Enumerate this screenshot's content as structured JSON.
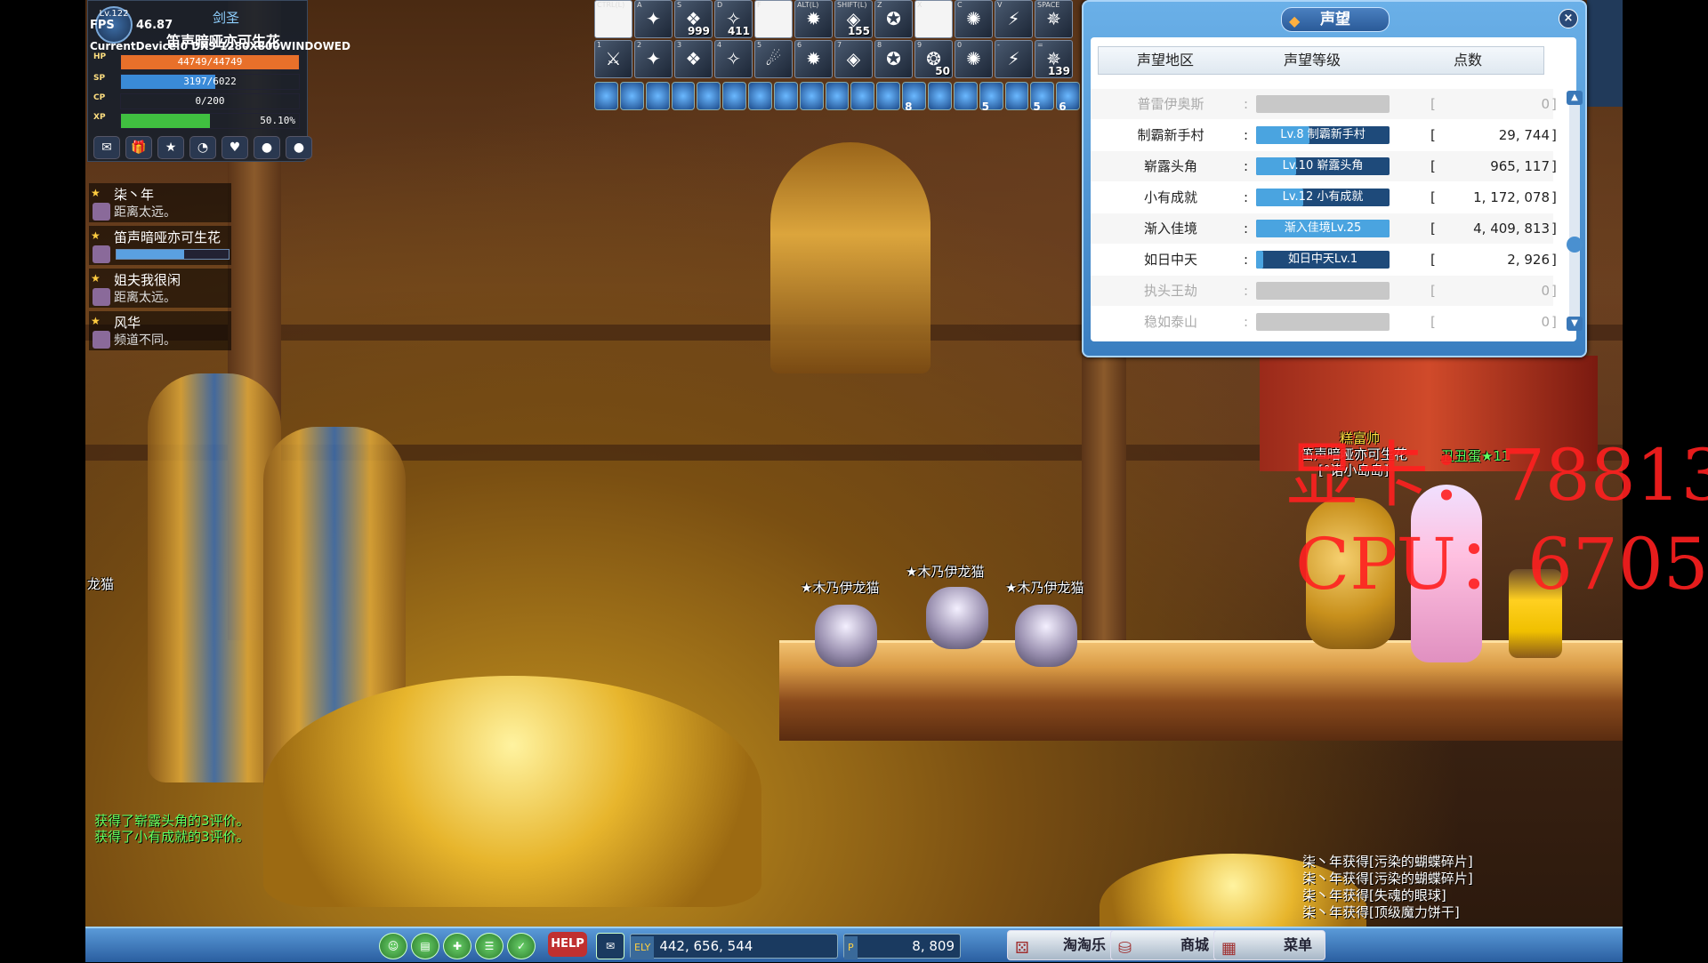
{
  "status": {
    "level_badge": "Lv.122",
    "class_name": "剑圣",
    "fps_label": "FPS",
    "fps_value": "46.87",
    "device_text": "CurrentDevice:0 DX9 1280X800WINDOWED",
    "player_name": "笛声暗哑亦可生花",
    "hp": {
      "label": "HP",
      "text": "44749/44749",
      "fraction": 1.0,
      "color": "#e8702a"
    },
    "sp": {
      "label": "SP",
      "text": "3197/6022",
      "fraction": 0.53,
      "color": "#3a8ad8"
    },
    "cp": {
      "label": "CP",
      "text": "0/200",
      "fraction": 0.0,
      "color": "#6a6aaa"
    },
    "xp": {
      "label": "XP",
      "text": "50.10%",
      "fraction": 0.501,
      "color": "#40c040"
    },
    "icons": [
      "mail-icon",
      "gift-icon",
      "star-icon",
      "clock-icon",
      "heart-icon",
      "orb-icon",
      "orb2-icon"
    ]
  },
  "party": [
    {
      "name": "柒丶年",
      "sub": "距离太远。"
    },
    {
      "name": "笛声暗哑亦可生花",
      "hp_fraction": 0.6
    },
    {
      "name": "姐夫我很闲",
      "sub": "距离太远。"
    },
    {
      "name": "风华",
      "sub": "频道不同。"
    }
  ],
  "skills": {
    "row1": [
      {
        "key": "CTRL(L)",
        "count": "",
        "empty": true
      },
      {
        "key": "A",
        "count": ""
      },
      {
        "key": "S",
        "count": "999"
      },
      {
        "key": "D",
        "count": "411"
      },
      {
        "key": "F",
        "count": "",
        "empty": true
      },
      {
        "key": "ALT(L)",
        "count": ""
      },
      {
        "key": "SHIFT(L)",
        "count": "155"
      },
      {
        "key": "Z",
        "count": ""
      },
      {
        "key": "X",
        "count": "",
        "empty": true
      },
      {
        "key": "C",
        "count": ""
      },
      {
        "key": "V",
        "count": ""
      },
      {
        "key": "SPACE",
        "count": ""
      }
    ],
    "row2": [
      {
        "key": "1",
        "count": ""
      },
      {
        "key": "2",
        "count": ""
      },
      {
        "key": "3",
        "count": ""
      },
      {
        "key": "4",
        "count": ""
      },
      {
        "key": "5",
        "count": ""
      },
      {
        "key": "6",
        "count": ""
      },
      {
        "key": "7",
        "count": ""
      },
      {
        "key": "8",
        "count": ""
      },
      {
        "key": "9",
        "count": "50"
      },
      {
        "key": "0",
        "count": ""
      },
      {
        "key": "-",
        "count": ""
      },
      {
        "key": "=",
        "count": "139"
      }
    ],
    "buff_counts": [
      "",
      "",
      "",
      "",
      "",
      "",
      "",
      "",
      "",
      "",
      "",
      "",
      "8",
      "",
      "",
      "5",
      "",
      "5",
      "6"
    ]
  },
  "reputation": {
    "title": "声望",
    "headers": [
      "声望地区",
      "声望等级",
      "点数"
    ],
    "rows": [
      {
        "area": "普雷伊奥斯",
        "level": "",
        "fill": 0,
        "points": "0",
        "dim": true
      },
      {
        "area": "制霸新手村",
        "level": "Lv.8 制霸新手村",
        "fill": 0.4,
        "points": "29, 744",
        "dim": false
      },
      {
        "area": "崭露头角",
        "level": "Lv.10 崭露头角",
        "fill": 0.3,
        "points": "965, 117",
        "dim": false
      },
      {
        "area": "小有成就",
        "level": "Lv.12 小有成就",
        "fill": 0.35,
        "points": "1, 172, 078",
        "dim": false
      },
      {
        "area": "渐入佳境",
        "level": "渐入佳境Lv.25",
        "fill": 1.0,
        "points": "4, 409, 813",
        "dim": false
      },
      {
        "area": "如日中天",
        "level": "如日中天Lv.1",
        "fill": 0.05,
        "points": "2, 926",
        "dim": false
      },
      {
        "area": "执头王劫",
        "level": "",
        "fill": 0,
        "points": "0",
        "dim": true
      },
      {
        "area": "稳如泰山",
        "level": "",
        "fill": 0,
        "points": "0",
        "dim": true
      }
    ]
  },
  "world": {
    "mob_name": "★木乃伊龙猫",
    "left_edge_name": "龙猫",
    "player_title": "糕富帅",
    "player_tag": "笛声暗哑亦可生花",
    "player_guild": "[°诺小岛岛]",
    "pet_name": "丑丑蛋★11",
    "watermark_gpu": "显卡：78813",
    "watermark_cpu": "CPU：6705"
  },
  "system_messages": [
    "获得了崭露头角的3评价。",
    "获得了小有成就的3评价。"
  ],
  "chat_log": [
    "柒丶年获得[污染的蝴蝶碎片]",
    "柒丶年获得[污染的蝴蝶碎片]",
    "柒丶年获得[失魂的眼球]",
    "柒丶年获得[顶级魔力饼干]"
  ],
  "bottom": {
    "help_label": "HELP",
    "gold_tag": "ELY",
    "gold_value": "442, 656, 544",
    "points_tag": "P",
    "points_value": "8, 809",
    "btn_taotaole": "淘淘乐",
    "btn_shop": "商城",
    "btn_menu": "菜单"
  }
}
